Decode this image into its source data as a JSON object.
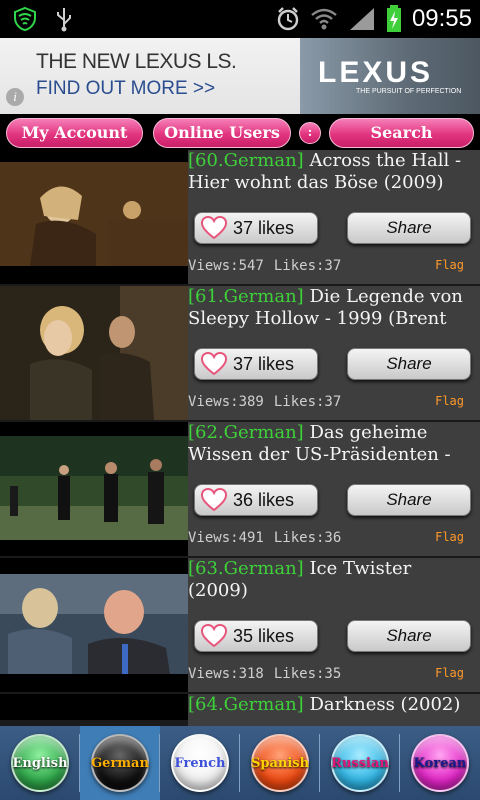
{
  "status_bar": {
    "time": "09:55",
    "icons": [
      "shield-icon",
      "usb-icon",
      "alarm-icon",
      "wifi-icon",
      "signal-icon",
      "battery-charging-icon"
    ]
  },
  "ad": {
    "headline": "THE NEW LEXUS LS.",
    "cta": "FIND OUT MORE >>",
    "brand": "LEXUS",
    "tagline": "THE PURSUIT OF PERFECTION",
    "info_icon": "info-icon"
  },
  "nav": {
    "my_account": "My Account",
    "online_users": "Online Users",
    "dot": ":",
    "search": "Search"
  },
  "items": [
    {
      "tag": "[60.German]",
      "title": "Across the Hall - Hier wohnt das Böse (2009)",
      "likes_label": "37 likes",
      "share_label": "Share",
      "views": "Views:547",
      "likes": "Likes:37",
      "flag": "Flag"
    },
    {
      "tag": "[61.German]",
      "title": "Die Legende von Sleepy Hollow - 1999 (Brent",
      "likes_label": "37 likes",
      "share_label": "Share",
      "views": "Views:389",
      "likes": "Likes:37",
      "flag": "Flag"
    },
    {
      "tag": "[62.German]",
      "title": "Das geheime Wissen der US-Präsidenten -",
      "likes_label": "36 likes",
      "share_label": "Share",
      "views": "Views:491",
      "likes": "Likes:36",
      "flag": "Flag"
    },
    {
      "tag": "[63.German]",
      "title": "Ice Twister (2009)",
      "likes_label": "35 likes",
      "share_label": "Share",
      "views": "Views:318",
      "likes": "Likes:35",
      "flag": "Flag"
    },
    {
      "tag": "[64.German]",
      "title": "Darkness (2002)"
    }
  ],
  "languages": [
    {
      "label": "English",
      "color": "#2fa84a"
    },
    {
      "label": "German",
      "color": "#111111"
    },
    {
      "label": "French",
      "color": "#f2f2f2"
    },
    {
      "label": "Spanish",
      "color": "#ef4a12"
    },
    {
      "label": "Russian",
      "color": "#31b7e6"
    },
    {
      "label": "Korean",
      "color": "#e326c8"
    }
  ],
  "colors": {
    "tag_green": "#3dd13a",
    "flag_orange": "#ff9a2a",
    "pill_pink": "#e2357f",
    "active_lang_bg": "#3f7db6"
  }
}
